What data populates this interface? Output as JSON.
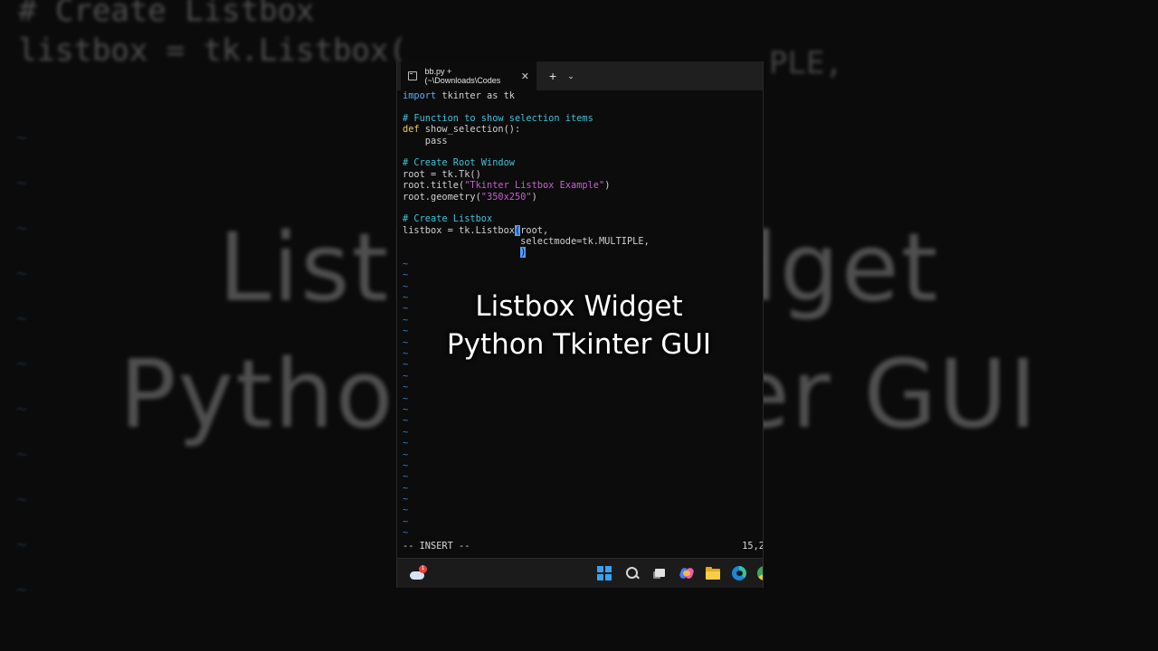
{
  "background": {
    "code_lines": [
      "# Create Listbox",
      "listbox = tk.Listbox("
    ],
    "right_text": "PLE,",
    "title_line1": "Listbox Widget",
    "title_line2": "Python Tkinter GUI"
  },
  "window": {
    "tab_title": "bb.py + (~\\Downloads\\Codes",
    "close_glyph": "✕",
    "new_tab_glyph": "+",
    "dropdown_glyph": "⌄"
  },
  "editor": {
    "lines": [
      "import tkinter as tk",
      "",
      "# Function to show selection items",
      "def show_selection():",
      "    pass",
      "",
      "# Create Root Window",
      "root = tk.Tk()",
      "root.title(\"Tkinter Listbox Example\")",
      "root.geometry(\"350x250\")",
      "",
      "# Create Listbox",
      "listbox = tk.Listbox(root,",
      "                     selectmode=tk.MULTIPLE,",
      "                     )"
    ],
    "tilde_count": 25,
    "mode": "-- INSERT --",
    "cursor_pos": "15,2"
  },
  "overlay": {
    "line1": "Listbox Widget",
    "line2": "Python Tkinter GUI"
  },
  "taskbar": {
    "weather_badge": "1",
    "icons": [
      "weather-icon",
      "windows-start-icon",
      "search-icon",
      "task-view-icon",
      "copilot-icon",
      "file-explorer-icon",
      "edge-icon",
      "chrome-icon"
    ]
  },
  "colors": {
    "keyword": "#5fa8ff",
    "def_keyword": "#e8c86a",
    "comment": "#3fc0d8",
    "string": "#c65fd1",
    "cursor": "#4f9dff",
    "tilde": "#3b78c7"
  }
}
